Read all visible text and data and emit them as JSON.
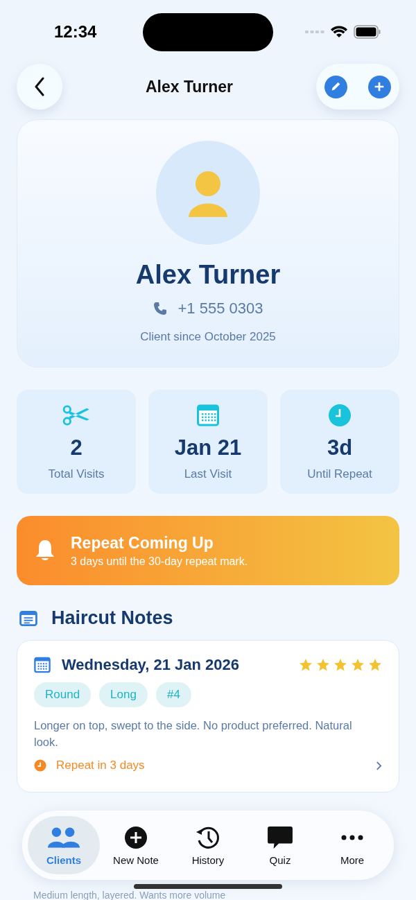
{
  "status_bar": {
    "time": "12:34"
  },
  "nav": {
    "title": "Alex Turner"
  },
  "profile": {
    "name": "Alex Turner",
    "phone": "+1 555 0303",
    "since": "Client since October 2025"
  },
  "stats": [
    {
      "kind": "scissors",
      "value": "2",
      "label": "Total Visits"
    },
    {
      "kind": "calendar",
      "value": "Jan 21",
      "label": "Last Visit"
    },
    {
      "kind": "clock",
      "value": "3d",
      "label": "Until Repeat"
    }
  ],
  "alert": {
    "title": "Repeat Coming Up",
    "message": "3 days until the 30-day repeat mark."
  },
  "section": {
    "title": "Haircut Notes"
  },
  "notes": [
    {
      "date": "Wednesday, 21 Jan 2026",
      "stars": 5,
      "tags": [
        "Round",
        "Long",
        "#4"
      ],
      "text": "Longer on top, swept to the side. No product preferred. Natural look.",
      "repeat": "Repeat in 3 days"
    }
  ],
  "partial_note": {
    "text": "Medium length, layered. Wants more volume"
  },
  "tabs": [
    {
      "kind": "people",
      "label": "Clients",
      "selected": true
    },
    {
      "kind": "plus",
      "label": "New Note",
      "selected": false
    },
    {
      "kind": "history",
      "label": "History",
      "selected": false
    },
    {
      "kind": "quiz",
      "label": "Quiz",
      "selected": false
    },
    {
      "kind": "more",
      "label": "More",
      "selected": false
    }
  ]
}
